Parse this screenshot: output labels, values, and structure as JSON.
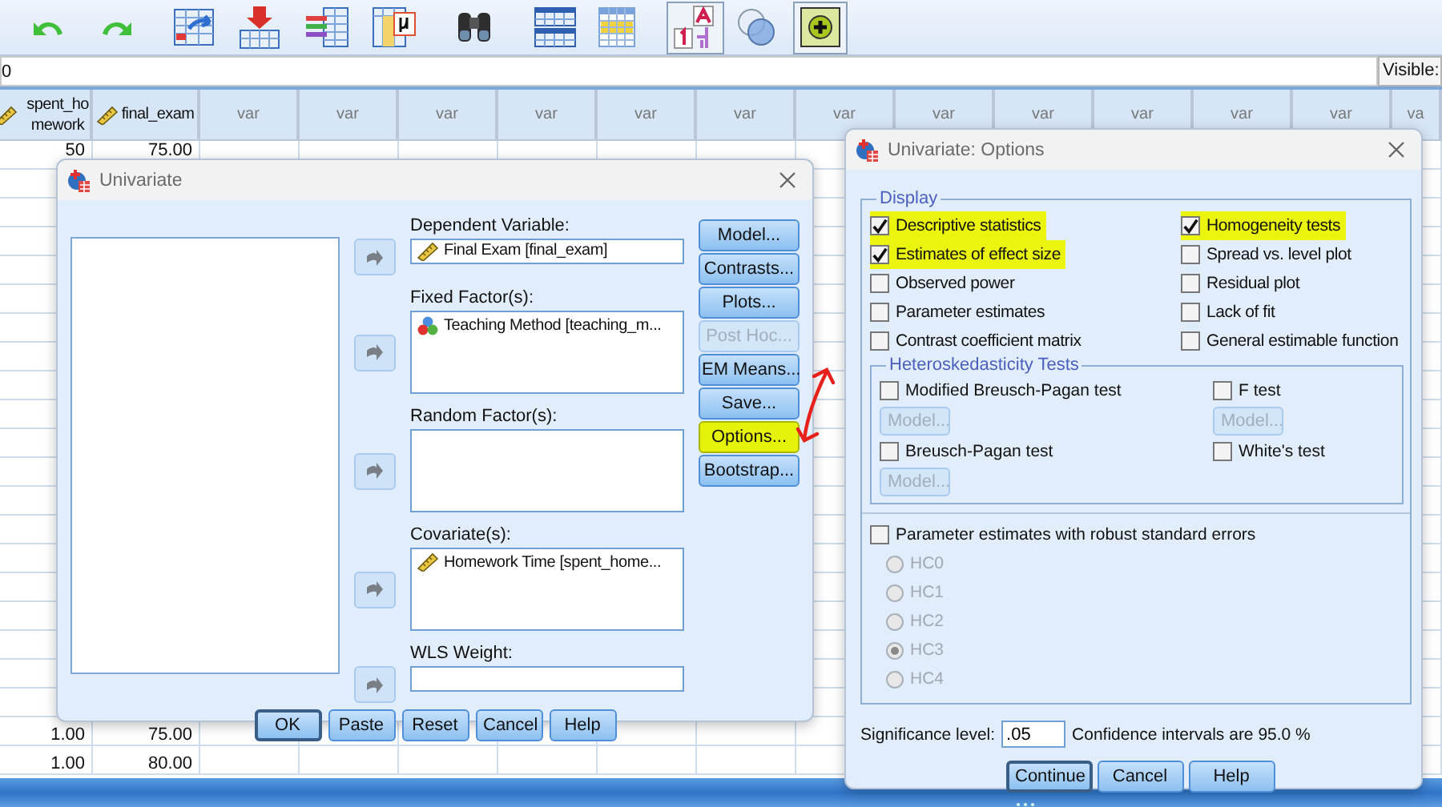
{
  "toolbar": {
    "buttons": [
      {
        "kind": "undo",
        "selected": false
      },
      {
        "kind": "redo",
        "selected": false
      },
      {
        "kind": "goto_case",
        "selected": false
      },
      {
        "kind": "insert_cases",
        "selected": false
      },
      {
        "kind": "insert_variable",
        "selected": false
      },
      {
        "kind": "statistics",
        "selected": false
      },
      {
        "kind": "find",
        "selected": false
      },
      {
        "kind": "split_file",
        "selected": false
      },
      {
        "kind": "weight_cases",
        "selected": false
      },
      {
        "kind": "value_labels",
        "selected": true
      },
      {
        "kind": "use_sets",
        "selected": false
      },
      {
        "kind": "extensions",
        "selected": true
      }
    ]
  },
  "formula_bar": {
    "value": "0",
    "visible_label": "Visible:"
  },
  "grid": {
    "columns": [
      {
        "label": "spent_homework",
        "kind": "scale"
      },
      {
        "label": "final_exam",
        "kind": "scale"
      },
      {
        "label": "var"
      },
      {
        "label": "var"
      },
      {
        "label": "var"
      },
      {
        "label": "var"
      },
      {
        "label": "var"
      },
      {
        "label": "var"
      },
      {
        "label": "var"
      },
      {
        "label": "var"
      },
      {
        "label": "var"
      },
      {
        "label": "var"
      },
      {
        "label": "var"
      },
      {
        "label": "var"
      },
      {
        "label": "va"
      }
    ],
    "rows": [
      {
        "cells": [
          "50",
          "75.00"
        ]
      },
      {
        "cells": [
          "1.00",
          "75.00"
        ]
      },
      {
        "cells": [
          "1.00",
          "80.00"
        ]
      }
    ]
  },
  "univariate": {
    "title": "Univariate",
    "targets": [
      {
        "label": "Dependent Variable:",
        "kind": "single",
        "items": [
          {
            "text": "Final Exam [final_exam]",
            "kind": "scale"
          }
        ]
      },
      {
        "label": "Fixed Factor(s):",
        "kind": "list",
        "items": [
          {
            "text": "Teaching Method [teaching_m...",
            "kind": "nominal"
          }
        ]
      },
      {
        "label": "Random Factor(s):",
        "kind": "list"
      },
      {
        "label": "Covariate(s):",
        "kind": "list",
        "items": [
          {
            "text": "Homework Time [spent_home...",
            "kind": "scale"
          }
        ]
      },
      {
        "label": "WLS Weight:",
        "kind": "single"
      }
    ],
    "side_buttons": [
      {
        "label": "Model...",
        "disabled": false,
        "highlighted": false
      },
      {
        "label": "Contrasts...",
        "disabled": false,
        "highlighted": false
      },
      {
        "label": "Plots...",
        "disabled": false,
        "highlighted": false
      },
      {
        "label": "Post Hoc...",
        "disabled": true,
        "highlighted": false
      },
      {
        "label": "EM Means...",
        "disabled": false,
        "highlighted": false
      },
      {
        "label": "Save...",
        "disabled": false,
        "highlighted": false
      },
      {
        "label": "Options...",
        "disabled": false,
        "highlighted": true
      },
      {
        "label": "Bootstrap...",
        "disabled": false,
        "highlighted": false
      }
    ],
    "buttons": [
      {
        "label": "OK",
        "default": true
      },
      {
        "label": "Paste",
        "default": false
      },
      {
        "label": "Reset",
        "default": false
      },
      {
        "label": "Cancel",
        "default": false
      },
      {
        "label": "Help",
        "default": false
      }
    ]
  },
  "options": {
    "title": "Univariate: Options",
    "display": {
      "title": "Display",
      "left": [
        {
          "label": "Descriptive statistics",
          "checked": true,
          "highlighted": true
        },
        {
          "label": "Estimates of effect size",
          "checked": true,
          "highlighted": true
        },
        {
          "label": "Observed power",
          "checked": false,
          "highlighted": false
        },
        {
          "label": "Parameter estimates",
          "checked": false,
          "highlighted": false
        },
        {
          "label": "Contrast coefficient matrix",
          "checked": false,
          "highlighted": false
        }
      ],
      "right": [
        {
          "label": "Homogeneity tests",
          "checked": true,
          "highlighted": true
        },
        {
          "label": "Spread vs. level plot",
          "checked": false,
          "highlighted": false
        },
        {
          "label": "Residual plot",
          "checked": false,
          "highlighted": false
        },
        {
          "label": "Lack of fit",
          "checked": false,
          "highlighted": false
        },
        {
          "label": "General estimable function",
          "checked": false,
          "highlighted": false
        }
      ]
    },
    "heteroskedasticity": {
      "title": "Heteroskedasticity Tests",
      "tests": [
        {
          "label": "Modified Breusch-Pagan test",
          "checked": false,
          "model_button": "Model..."
        },
        {
          "label": "F test",
          "checked": false,
          "model_button": "Model..."
        },
        {
          "label": "Breusch-Pagan test",
          "checked": false,
          "model_button": "Model..."
        },
        {
          "label": "White's test",
          "checked": false
        }
      ]
    },
    "robust": {
      "label": "Parameter estimates with robust standard errors",
      "checked": false,
      "disabled": true,
      "choices": [
        {
          "label": "HC0",
          "selected": false
        },
        {
          "label": "HC1",
          "selected": false
        },
        {
          "label": "HC2",
          "selected": false
        },
        {
          "label": "HC3",
          "selected": true
        },
        {
          "label": "HC4",
          "selected": false
        }
      ]
    },
    "significance": {
      "label": "Significance level:",
      "value": ".05",
      "note": "Confidence intervals are 95.0 %"
    },
    "buttons": [
      {
        "label": "Continue",
        "default": true
      },
      {
        "label": "Cancel",
        "default": false
      },
      {
        "label": "Help",
        "default": false
      }
    ]
  }
}
